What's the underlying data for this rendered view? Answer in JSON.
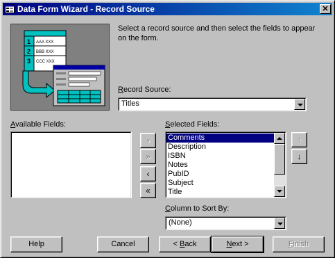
{
  "window": {
    "title": "Data Form Wizard - Record Source",
    "close_glyph": "✕"
  },
  "intro_text": "Select a record source and then select the fields to appear on the form.",
  "illustration": {
    "rows": [
      {
        "num": "1",
        "text": "AAA XXX"
      },
      {
        "num": "2",
        "text": "BBB XXX"
      },
      {
        "num": "3",
        "text": "CCC XXX"
      }
    ]
  },
  "record_source": {
    "label_prefix": "",
    "label_accel": "R",
    "label_rest": "ecord Source:",
    "value": "Titles"
  },
  "available_fields": {
    "label_accel": "A",
    "label_rest": "vailable Fields:",
    "items": []
  },
  "selected_fields": {
    "label_accel": "S",
    "label_rest": "elected Fields:",
    "items": [
      "Comments",
      "Description",
      "ISBN",
      "Notes",
      "PubID",
      "Subject",
      "Title"
    ],
    "selected_index": 0
  },
  "move_buttons": {
    "add": "›",
    "add_all": "»",
    "remove": "‹",
    "remove_all": "«"
  },
  "order_buttons": {
    "up": "↑",
    "down": "↓"
  },
  "sort_by": {
    "label_prefix": "",
    "label_accel": "C",
    "label_rest": "olumn to Sort By:",
    "value": "(None)"
  },
  "buttons": {
    "help": "Help",
    "cancel": "Cancel",
    "back_prefix": "< ",
    "back_accel": "B",
    "back_rest": "ack",
    "next_accel": "N",
    "next_rest": "ext >",
    "finish_accel": "F",
    "finish_rest": "inish"
  },
  "colors": {
    "title_bar": "#000080",
    "selection": "#000080",
    "face": "#c0c0c0",
    "illustration_accent": "#00c0c0"
  }
}
